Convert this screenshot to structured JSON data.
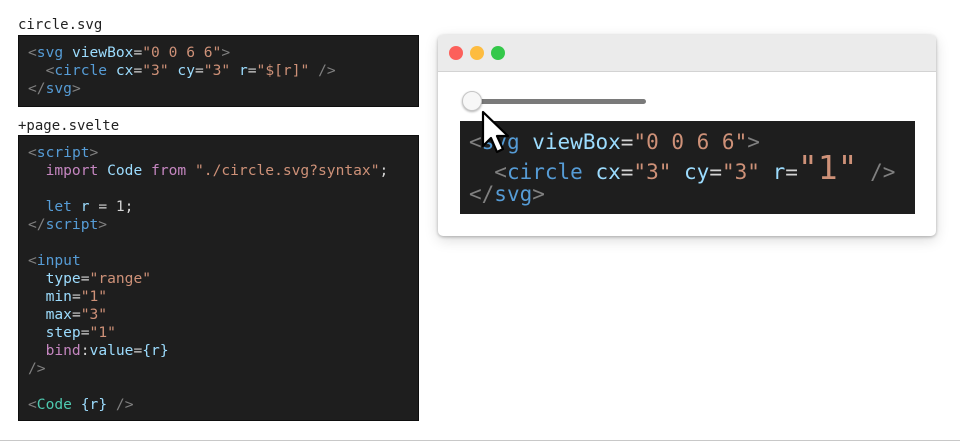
{
  "files": {
    "circle": {
      "name": "circle.svg",
      "code": {
        "l1_open": "<",
        "l1_tag": "svg",
        "l1_attr": "viewBox",
        "l1_eq": "=",
        "l1_val": "\"0 0 6 6\"",
        "l1_close": ">",
        "l2_open": "<",
        "l2_tag": "circle",
        "l2_a1": "cx",
        "l2_eq1": "=",
        "l2_v1": "\"3\"",
        "l2_a2": "cy",
        "l2_eq2": "=",
        "l2_v2": "\"3\"",
        "l2_a3": "r",
        "l2_eq3": "=",
        "l2_v3": "\"$[r]\"",
        "l2_close": "/>",
        "l3_open": "</",
        "l3_tag": "svg",
        "l3_close": ">"
      }
    },
    "page": {
      "name": "+page.svelte",
      "code": {
        "s_open": "<",
        "s_tag": "script",
        "s_close": ">",
        "imp_kw": "import",
        "imp_name": "Code",
        "imp_from": "from",
        "imp_str": "\"./circle.svg?syntax\"",
        "imp_semi": ";",
        "let_kw": "let",
        "let_var": "r",
        "let_rest": " = 1;",
        "se_open": "</",
        "se_tag": "script",
        "se_close": ">",
        "in_open": "<",
        "in_tag": "input",
        "type_attr": "type",
        "type_eq": "=",
        "type_val": "\"range\"",
        "min_attr": "min",
        "min_eq": "=",
        "min_val": "\"1\"",
        "max_attr": "max",
        "max_eq": "=",
        "max_val": "\"3\"",
        "step_attr": "step",
        "step_eq": "=",
        "step_val": "\"1\"",
        "bind_kw": "bind",
        "bind_colon": ":",
        "bind_attr": "value",
        "bind_eq": "=",
        "bind_val": "{r}",
        "in_close": "/>",
        "c_open": "<",
        "c_tag": "Code",
        "c_val": "{r}",
        "c_close": "/>"
      }
    }
  },
  "preview": {
    "slider": {
      "min": 1,
      "max": 3,
      "step": 1,
      "value": 1
    },
    "code": {
      "l1_open": "<",
      "l1_tag": "svg",
      "l1_attr": "viewBox",
      "l1_eq": "=",
      "l1_val": "\"0 0 6 6\"",
      "l1_close": ">",
      "l2_open": "<",
      "l2_tag": "circle",
      "l2_a1": "cx",
      "l2_eq1": "=",
      "l2_v1": "\"3\"",
      "l2_a2": "cy",
      "l2_eq2": "=",
      "l2_v2": "\"3\"",
      "l2_a3": "r",
      "l2_eq3": "=",
      "l2_q1": "\"",
      "l2_num": "1",
      "l2_q2": "\"",
      "l2_close": "/>",
      "l3_open": "</",
      "l3_tag": "svg",
      "l3_close": ">"
    }
  },
  "colors": {
    "window_close": "#fc605b",
    "window_minimize": "#fdbc40",
    "window_zoom": "#34c84a",
    "code_bg": "#1e1e1e"
  },
  "icons": {
    "cursor": "mouse-pointer-icon"
  }
}
